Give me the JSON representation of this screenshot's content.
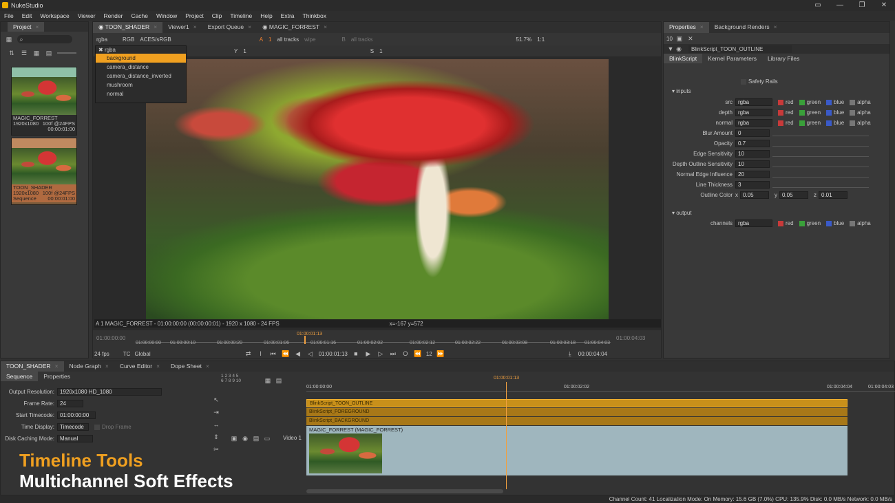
{
  "app": {
    "title": "NukeStudio",
    "menu": [
      "File",
      "Edit",
      "Workspace",
      "Viewer",
      "Render",
      "Cache",
      "Window",
      "Project",
      "Clip",
      "Timeline",
      "Help",
      "Extra",
      "Thinkbox"
    ]
  },
  "project": {
    "tab": "Project",
    "items": [
      {
        "name": "MAGIC_FORREST",
        "res": "1920x1080",
        "info": "100f @24FPS",
        "tc": "00:00:01:00"
      },
      {
        "name": "TOON_SHADER",
        "res": "1920x1080",
        "info": "100f @24FPS",
        "type": "Sequence",
        "tc": "00:00:01:00"
      }
    ]
  },
  "viewer": {
    "tabs": [
      "TOON_SHADER",
      "Viewer1",
      "Export Queue",
      "MAGIC_FORREST"
    ],
    "controls": {
      "channel": "rgba",
      "rgb": "RGB",
      "colorspace": "ACES/sRGB",
      "a_label": "A",
      "a_val": "1",
      "a_tracks": "all tracks",
      "wipe": "wipe",
      "b_label": "B",
      "b_tracks": "all tracks",
      "zoom": "51.7%",
      "ratio": "1:1",
      "y_label": "Y",
      "y_val": "1",
      "s_label": "S",
      "s_val": "1"
    },
    "dropdown": {
      "header": "rgba",
      "items": [
        "background",
        "camera_distance",
        "camera_distance_inverted",
        "mushroom",
        "normal"
      ],
      "selected": 0
    },
    "info": "A 1 MAGIC_FORREST - 01:00:00:00 (00:00:00:01) - 1920 x 1080 - 24 FPS",
    "coords": "x=-167 y=572",
    "ruler": [
      "01:00:00:00",
      "01:00:00:10",
      "01:00:00:20",
      "01:00:01:06",
      "01:00:01:16",
      "01:00:02:02",
      "01:00:02:12",
      "01:00:02:22",
      "01:00:03:08",
      "01:00:03:18",
      "01:00:04:03"
    ],
    "start": "01:00:00:00",
    "end": "01:00:04:03",
    "playhead": "01:00:01:13",
    "fps": "24 fps",
    "tc": "TC",
    "global": "Global",
    "current": "01:00:01:13",
    "step": "12",
    "duration": "00:00:04:04"
  },
  "properties": {
    "tabs": [
      "Properties",
      "Background Renders"
    ],
    "count": "10",
    "node": "BlinkScript_TOON_OUTLINE",
    "subtabs": [
      "BlinkScript",
      "Kernel Parameters",
      "Library Files"
    ],
    "safety": "Safety Rails",
    "inputs_label": "inputs",
    "channels": [
      {
        "name": "src",
        "val": "rgba"
      },
      {
        "name": "depth",
        "val": "rgba"
      },
      {
        "name": "normal",
        "val": "rgba"
      }
    ],
    "rgba": [
      "red",
      "green",
      "blue",
      "alpha"
    ],
    "params": [
      {
        "name": "Blur Amount",
        "val": "0"
      },
      {
        "name": "Opacity",
        "val": "0.7"
      },
      {
        "name": "Edge Sensitivity",
        "val": "10"
      },
      {
        "name": "Depth Outline Sensitivity",
        "val": "10"
      },
      {
        "name": "Normal Edge Influence",
        "val": "20"
      },
      {
        "name": "Line Thickness",
        "val": "3"
      }
    ],
    "outline": {
      "label": "Outline Color",
      "x": "x",
      "xv": "0.05",
      "y": "y",
      "yv": "0.05",
      "z": "z",
      "zv": "0.01"
    },
    "output_label": "output",
    "out_channels": {
      "name": "channels",
      "val": "rgba"
    }
  },
  "timeline": {
    "tabs": [
      "TOON_SHADER",
      "Node Graph",
      "Curve Editor",
      "Dope Sheet"
    ],
    "subtabs": [
      "Sequence",
      "Properties"
    ],
    "settings": [
      {
        "label": "Output Resolution:",
        "val": "1920x1080 HD_1080"
      },
      {
        "label": "Frame Rate:",
        "val": "24"
      },
      {
        "label": "Start Timecode:",
        "val": "01:00:00:00"
      },
      {
        "label": "Time Display:",
        "val": "Timecode"
      },
      {
        "label": "Disk Caching Mode:",
        "val": "Manual"
      }
    ],
    "drop_frame": "Drop Frame",
    "track_nums": [
      "1",
      "2",
      "3",
      "4",
      "5",
      "6",
      "7",
      "8",
      "9",
      "10"
    ],
    "ruler": [
      "01:00:00:00",
      "01:00:01:13",
      "01:00:02:02",
      "01:00:04:04",
      "01:00:04:03"
    ],
    "tracks": [
      "BlinkScript_TOON_OUTLINE",
      "BlinkScript_FOREGROUND",
      "BlinkScript_BACKGROUND"
    ],
    "clip": "MAGIC_FORREST (MAGIC_FORREST)",
    "video_label": "Video 1"
  },
  "overlay": {
    "line1": "Timeline Tools",
    "line2": "Multichannel Soft Effects"
  },
  "status": "Channel Count: 41  Localization Mode: On  Memory: 15.6 GB (7.0%)  CPU: 135.9%  Disk: 0.0 MB/s  Network: 0.0 MB/s"
}
